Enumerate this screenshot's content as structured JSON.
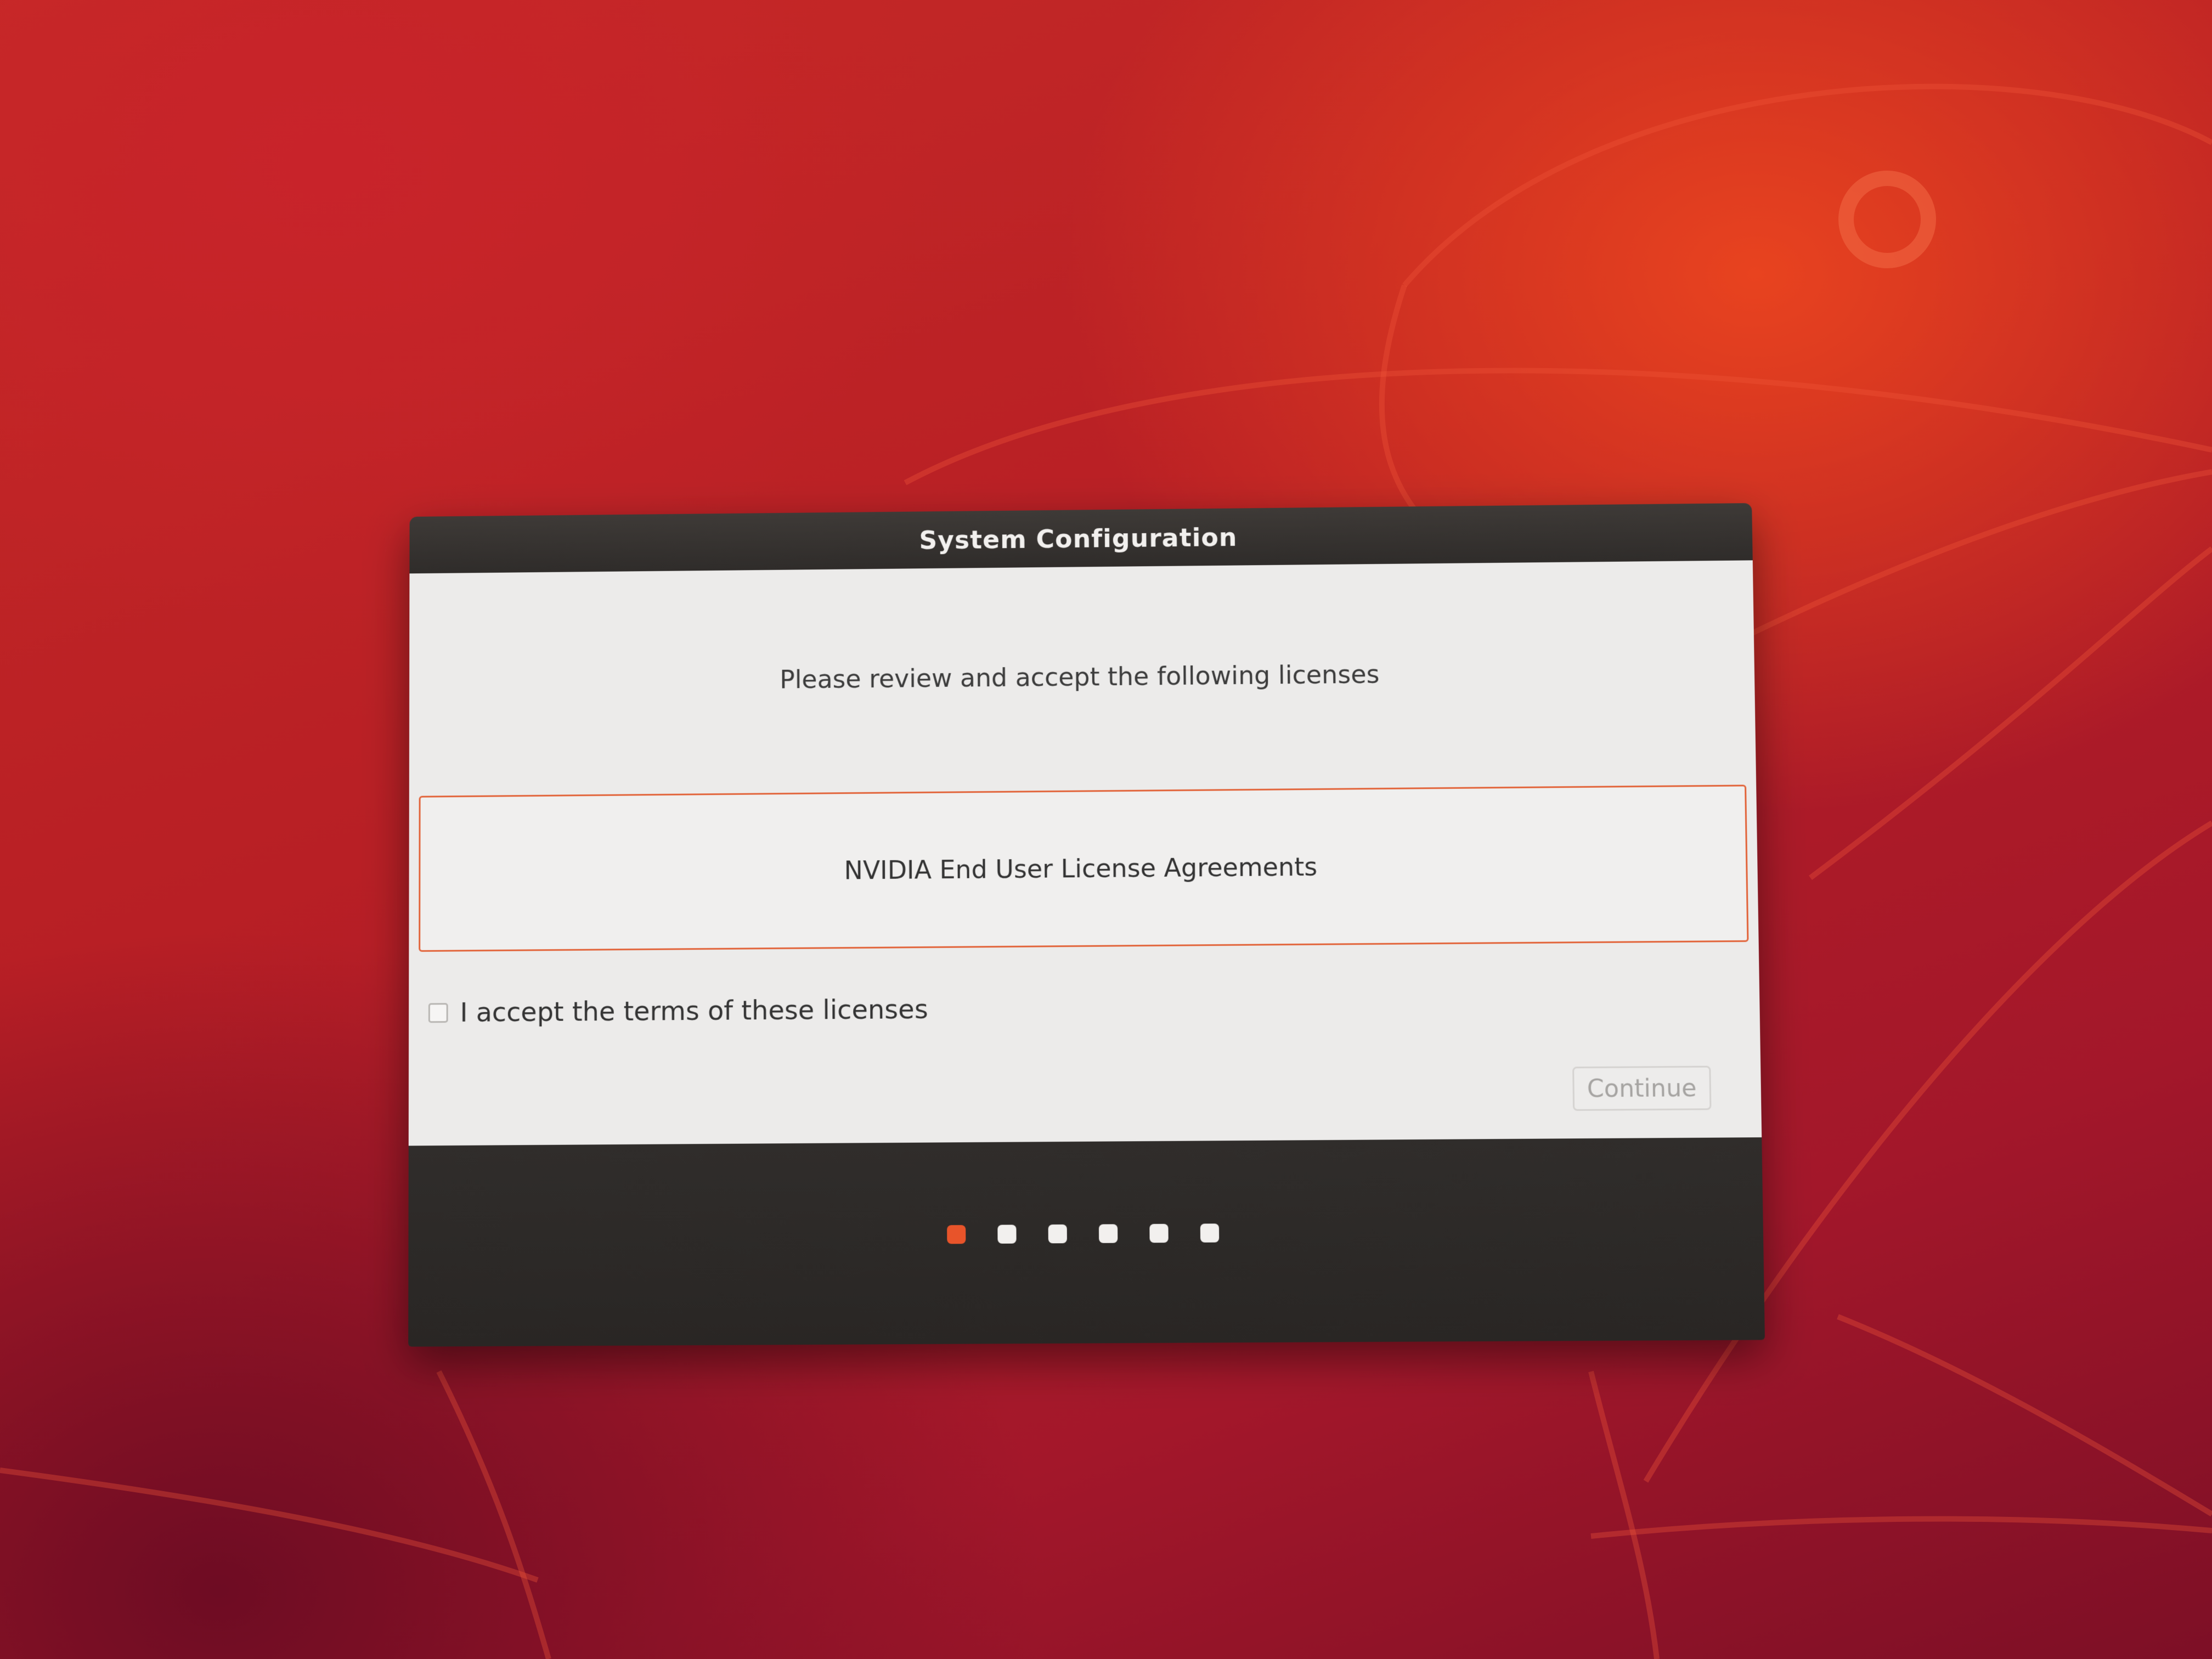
{
  "dialog": {
    "title": "System Configuration",
    "prompt": "Please review and accept the following licenses",
    "licenses": [
      {
        "label": "NVIDIA End User License Agreements"
      }
    ],
    "accept_checkbox": {
      "label": "I accept the terms of these licenses",
      "checked": false
    },
    "continue_button": {
      "label": "Continue",
      "enabled": false
    }
  },
  "progress": {
    "total_steps": 6,
    "current_step": 1
  },
  "colors": {
    "accent": "#e8542a",
    "titlebar": "#2f2c2a",
    "dialog_background": "#ecebea",
    "wallpaper": "#c62a26"
  }
}
